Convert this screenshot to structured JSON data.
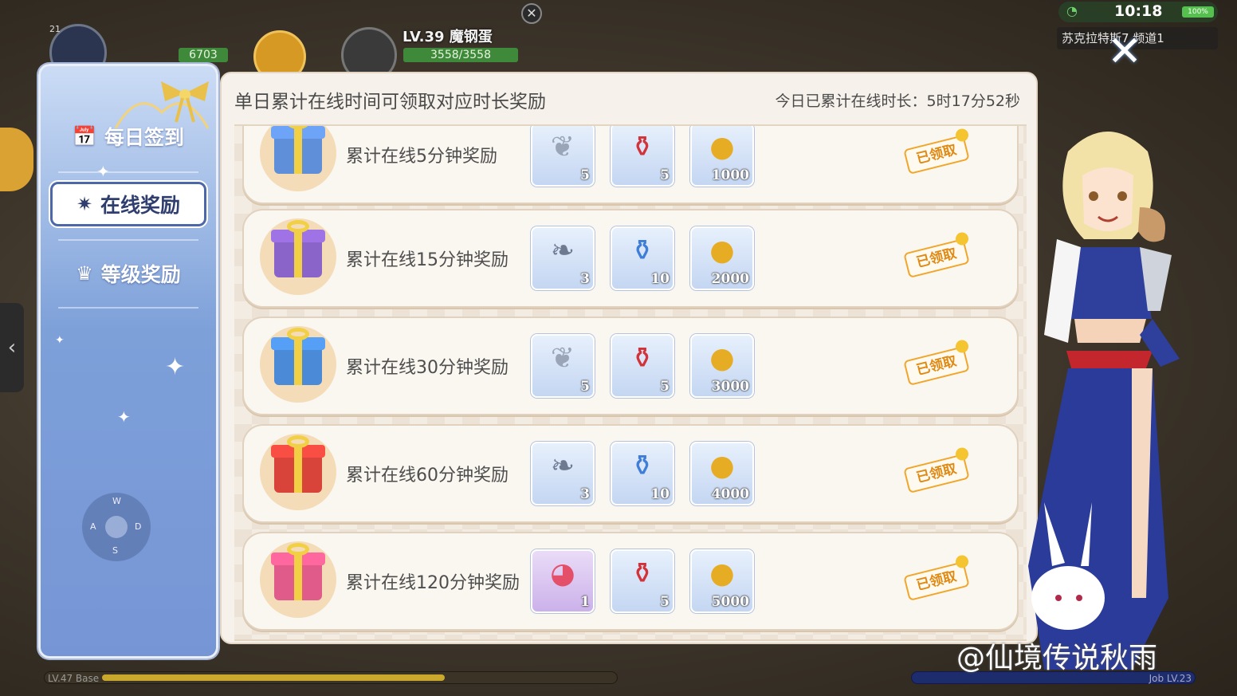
{
  "hud": {
    "player_level_name": "LV.39 魔钢蛋",
    "player_hp": "3558/3558",
    "exp_value": "6703",
    "avatar_badge": "21",
    "clock": "10:18",
    "battery": "100%",
    "server": "苏克拉特斯7 频道1",
    "bottom_base_label": "LV.47 Base",
    "bottom_job_label": "Job LV.23"
  },
  "sidebar": {
    "items": [
      {
        "label": "每日签到",
        "icon": "calendar-check-icon",
        "selected": false
      },
      {
        "label": "在线奖励",
        "icon": "sparkle-icon",
        "selected": true
      },
      {
        "label": "等级奖励",
        "icon": "crown-icon",
        "selected": false
      }
    ],
    "joystick_keys": [
      "W",
      "A",
      "S",
      "D"
    ]
  },
  "main": {
    "title": "单日累计在线时间可领取对应时长奖励",
    "online_time": "今日已累计在线时长：5时17分52秒",
    "rows": [
      {
        "label": "累计在线5分钟奖励",
        "gift_color": "#5f8fd8",
        "items": [
          {
            "icon": "butterfly-wing-icon",
            "count": "5",
            "style": "blue"
          },
          {
            "icon": "red-potion-icon",
            "count": "5",
            "style": "blue"
          },
          {
            "icon": "gold-coin-icon",
            "count": "1000",
            "style": "blue"
          }
        ],
        "status": "已领取"
      },
      {
        "label": "累计在线15分钟奖励",
        "gift_color": "#8a64c8",
        "items": [
          {
            "icon": "fly-wing-icon",
            "count": "3",
            "style": "blue"
          },
          {
            "icon": "blue-potion-icon",
            "count": "10",
            "style": "blue"
          },
          {
            "icon": "gold-coin-icon",
            "count": "2000",
            "style": "blue"
          }
        ],
        "status": "已领取"
      },
      {
        "label": "累计在线30分钟奖励",
        "gift_color": "#4a8ad6",
        "items": [
          {
            "icon": "butterfly-wing-icon",
            "count": "5",
            "style": "blue"
          },
          {
            "icon": "red-potion-icon",
            "count": "5",
            "style": "blue"
          },
          {
            "icon": "gold-coin-icon",
            "count": "3000",
            "style": "blue"
          }
        ],
        "status": "已领取"
      },
      {
        "label": "累计在线60分钟奖励",
        "gift_color": "#d8443a",
        "items": [
          {
            "icon": "fly-wing-icon",
            "count": "3",
            "style": "blue"
          },
          {
            "icon": "blue-potion-icon",
            "count": "10",
            "style": "blue"
          },
          {
            "icon": "gold-coin-icon",
            "count": "4000",
            "style": "blue"
          }
        ],
        "status": "已领取"
      },
      {
        "label": "累计在线120分钟奖励",
        "gift_color": "#e05a8a",
        "items": [
          {
            "icon": "poring-pet-icon",
            "count": "1",
            "style": "purple"
          },
          {
            "icon": "red-potion-icon",
            "count": "5",
            "style": "blue"
          },
          {
            "icon": "gold-coin-icon",
            "count": "5000",
            "style": "blue"
          }
        ],
        "status": "已领取"
      }
    ]
  },
  "watermark": "@仙境传说秋雨",
  "colors": {
    "panel_blue": "#7da0d9",
    "content_bg": "#f6f1ea",
    "stamp_orange": "#e08a14",
    "selected_tab_border": "#4c68a8"
  }
}
